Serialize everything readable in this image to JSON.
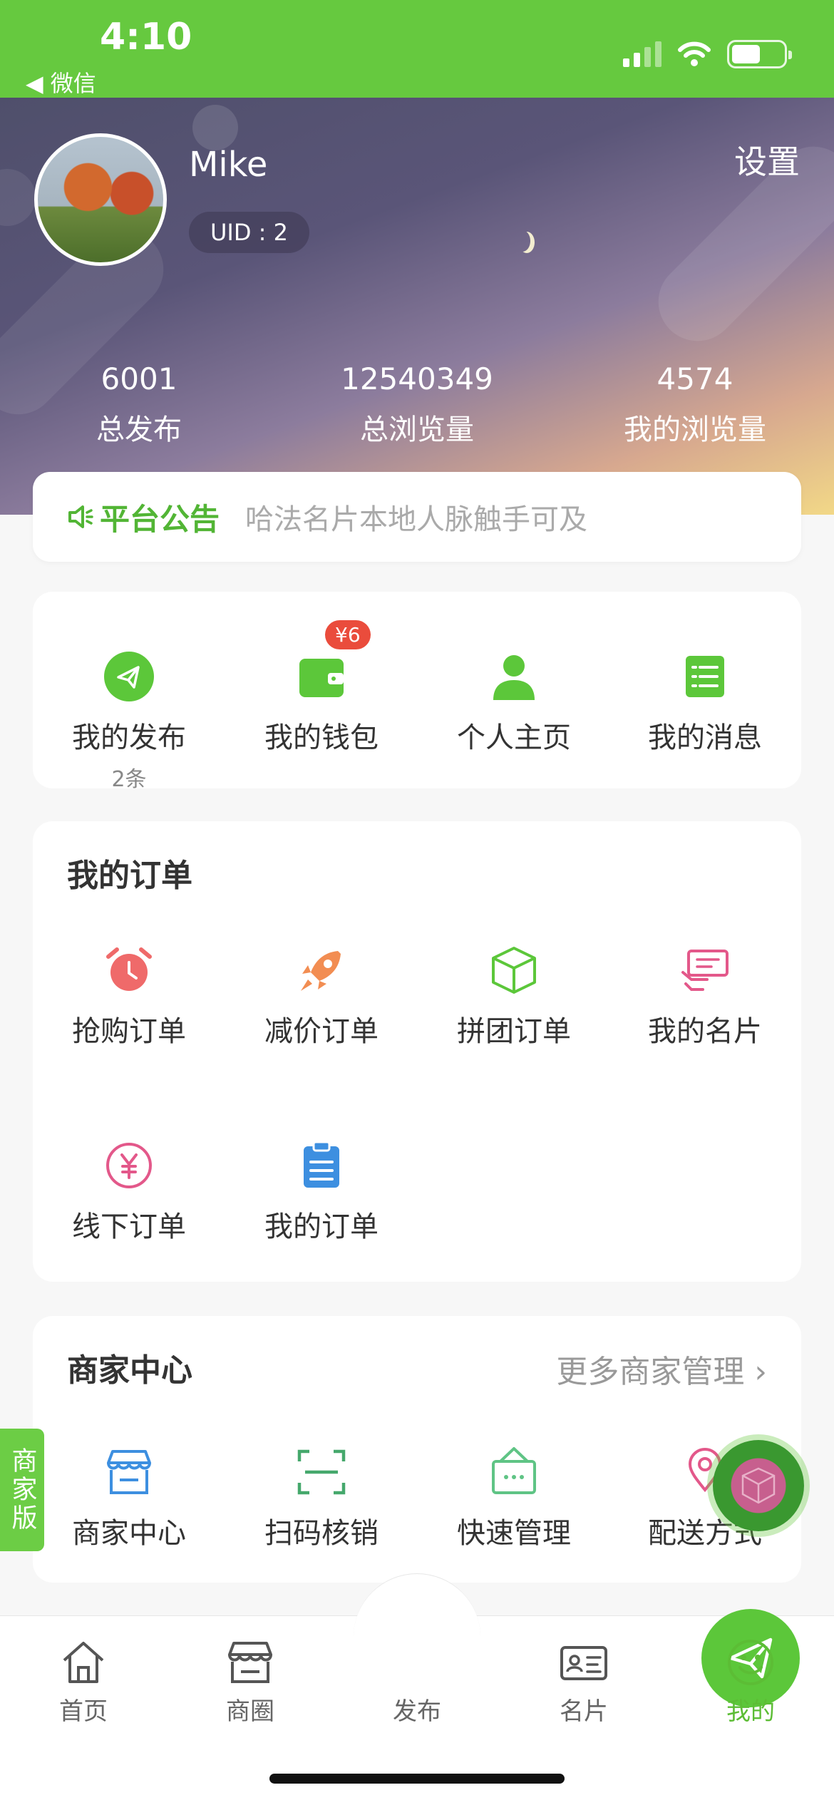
{
  "status": {
    "time": "4:10",
    "back_label": "◀ 微信"
  },
  "header": {
    "user_name": "Mike",
    "uid": "UID : 2",
    "settings_label": "设置",
    "stats": [
      {
        "value": "6001",
        "label": "总发布"
      },
      {
        "value": "12540349",
        "label": "总浏览量"
      },
      {
        "value": "4574",
        "label": "我的浏览量"
      }
    ]
  },
  "notice": {
    "title": "平台公告",
    "text": "哈法名片本地人脉触手可及"
  },
  "quick": {
    "items": [
      {
        "label": "我的发布",
        "sub": "2条"
      },
      {
        "label": "我的钱包",
        "badge": "¥6"
      },
      {
        "label": "个人主页"
      },
      {
        "label": "我的消息"
      }
    ]
  },
  "orders": {
    "title": "我的订单",
    "items": [
      {
        "label": "抢购订单"
      },
      {
        "label": "减价订单"
      },
      {
        "label": "拼团订单"
      },
      {
        "label": "我的名片"
      },
      {
        "label": "线下订单"
      },
      {
        "label": "我的订单"
      }
    ]
  },
  "merchant": {
    "title": "商家中心",
    "more": "更多商家管理 ›",
    "items": [
      {
        "label": "商家中心"
      },
      {
        "label": "扫码核销"
      },
      {
        "label": "快速管理"
      },
      {
        "label": "配送方式"
      }
    ]
  },
  "side_tab": {
    "label": "商家版"
  },
  "tabbar": {
    "items": [
      {
        "label": "首页"
      },
      {
        "label": "商圈"
      },
      {
        "label": "发布"
      },
      {
        "label": "名片"
      },
      {
        "label": "我的"
      }
    ]
  },
  "colors": {
    "brand": "#66c93f",
    "accent_red": "#ea4c3c"
  }
}
